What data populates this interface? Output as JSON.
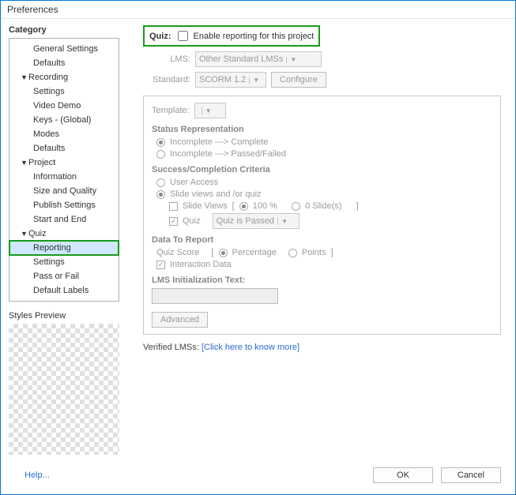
{
  "window": {
    "title": "Preferences"
  },
  "sidebar": {
    "heading": "Category",
    "items": [
      {
        "label": "General Settings",
        "level": 1
      },
      {
        "label": "Defaults",
        "level": 1
      },
      {
        "label": "Recording",
        "level": 0,
        "expanded": true
      },
      {
        "label": "Settings",
        "level": 1
      },
      {
        "label": "Video Demo",
        "level": 1
      },
      {
        "label": "Keys - (Global)",
        "level": 1
      },
      {
        "label": "Modes",
        "level": 1
      },
      {
        "label": "Defaults",
        "level": 1
      },
      {
        "label": "Project",
        "level": 0,
        "expanded": true
      },
      {
        "label": "Information",
        "level": 1
      },
      {
        "label": "Size and Quality",
        "level": 1
      },
      {
        "label": "Publish Settings",
        "level": 1
      },
      {
        "label": "Start and End",
        "level": 1
      },
      {
        "label": "Quiz",
        "level": 0,
        "expanded": true
      },
      {
        "label": "Reporting",
        "level": 1,
        "selected": true
      },
      {
        "label": "Settings",
        "level": 1
      },
      {
        "label": "Pass or Fail",
        "level": 1
      },
      {
        "label": "Default Labels",
        "level": 1
      }
    ],
    "preview_label": "Styles Preview"
  },
  "main": {
    "quiz_prefix": "Quiz:",
    "enable_label": "Enable reporting for this project",
    "lms_label": "LMS:",
    "lms_value": "Other Standard LMSs",
    "standard_label": "Standard:",
    "standard_value": "SCORM 1.2",
    "configure_btn": "Configure",
    "template_label": "Template:",
    "status_heading": "Status Representation",
    "status_opts": [
      "Incomplete ---> Complete",
      "Incomplete ---> Passed/Failed"
    ],
    "success_heading": "Success/Completion Criteria",
    "success_user_access": "User Access",
    "success_slide_quiz": "Slide views and /or quiz",
    "slide_views_label": "Slide Views",
    "slide_views_pct": "100 %",
    "slide_views_count": "0 Slide(s)",
    "quiz_chk": "Quiz",
    "quiz_dd": "Quiz is Passed",
    "data_heading": "Data To Report",
    "quiz_score_label": "Quiz Score",
    "quiz_score_pct": "Percentage",
    "quiz_score_pts": "Points",
    "interaction_data": "Interaction Data",
    "lms_init_heading": "LMS Initialization Text:",
    "advanced_btn": "Advanced",
    "verified_prefix": "Verified LMSs:",
    "verified_link": "[Click here to know more]"
  },
  "footer": {
    "help": "Help...",
    "ok": "OK",
    "cancel": "Cancel"
  }
}
